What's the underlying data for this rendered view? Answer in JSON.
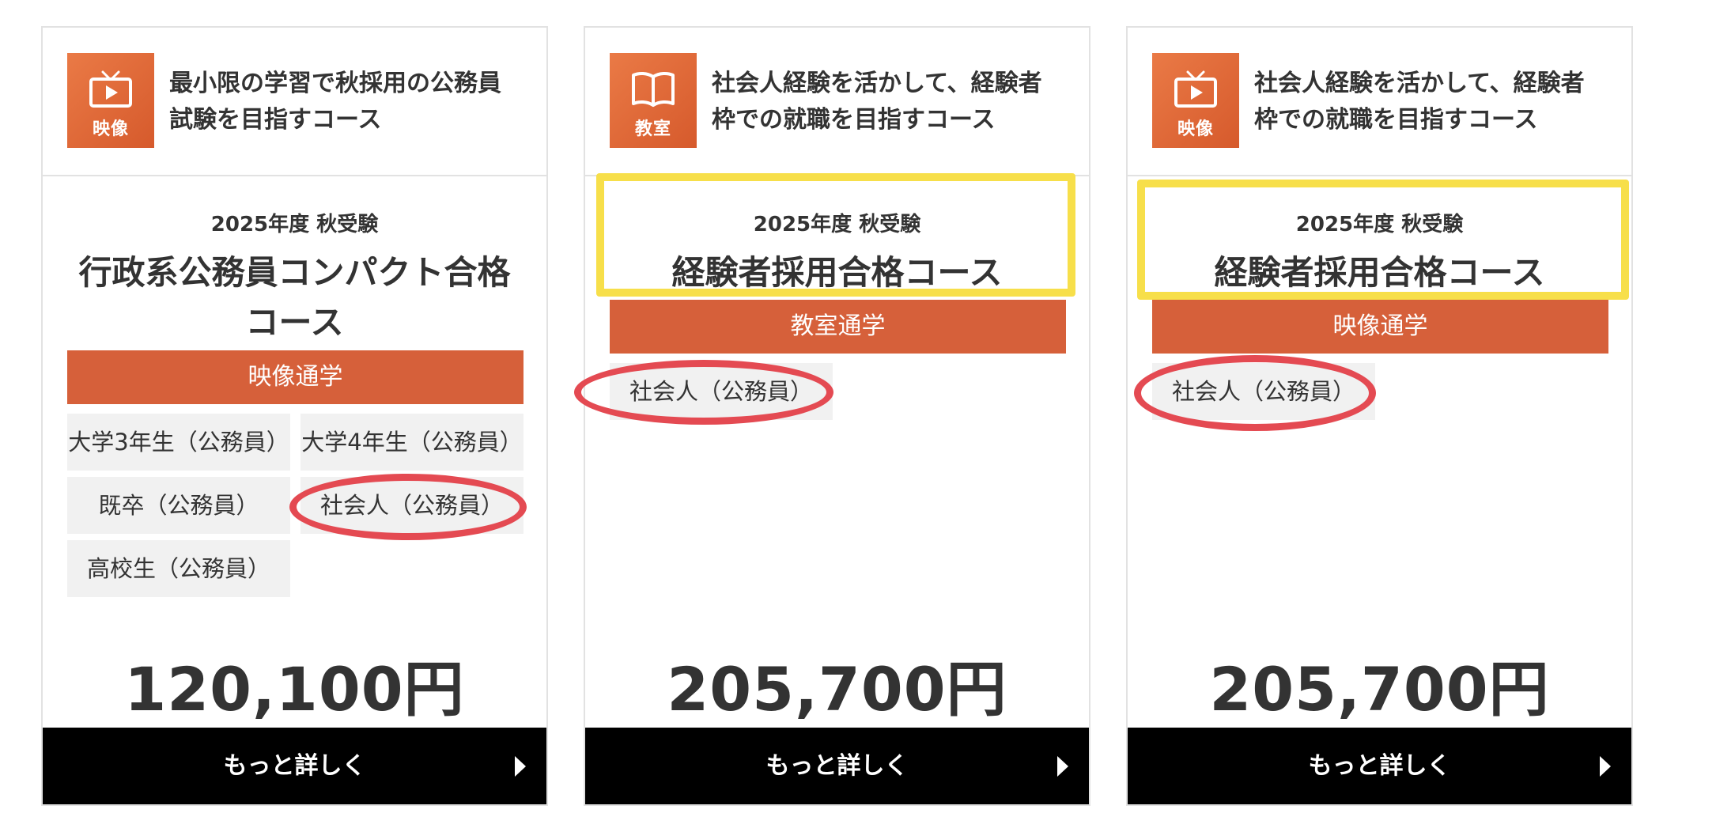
{
  "cards": [
    {
      "badge": {
        "icon": "tv-icon",
        "label": "映像"
      },
      "head_line1": "最小限の学習で秋採用の公務員",
      "head_line2": "試験を目指すコース",
      "year": "2025年度 秋受験",
      "title_line1": "行政系公務員コンパクト合格",
      "title_line2": "コース",
      "mode": "映像通学",
      "tags": [
        "大学3年生（公務員）",
        "大学4年生（公務員）",
        "既卒（公務員）",
        "社会人（公務員）",
        "高校生（公務員）"
      ],
      "price": "120,100円",
      "button_label": "もっと詳しく"
    },
    {
      "badge": {
        "icon": "book-icon",
        "label": "教室"
      },
      "head_line1": "社会人経験を活かして、経験者",
      "head_line2": "枠での就職を目指すコース",
      "year": "2025年度 秋受験",
      "title_line1": "経験者採用合格コース",
      "mode": "教室通学",
      "tags": [
        "社会人（公務員）"
      ],
      "price": "205,700円",
      "button_label": "もっと詳しく"
    },
    {
      "badge": {
        "icon": "tv-icon",
        "label": "映像"
      },
      "head_line1": "社会人経験を活かして、経験者",
      "head_line2": "枠での就職を目指すコース",
      "year": "2025年度 秋受験",
      "title_line1": "経験者採用合格コース",
      "mode": "映像通学",
      "tags": [
        "社会人（公務員）"
      ],
      "price": "205,700円",
      "button_label": "もっと詳しく"
    }
  ],
  "colors": {
    "accent_orange": "#d6603a",
    "highlight_yellow": "#f7df4a",
    "annotation_red": "#e44a52",
    "button_black": "#000000"
  }
}
